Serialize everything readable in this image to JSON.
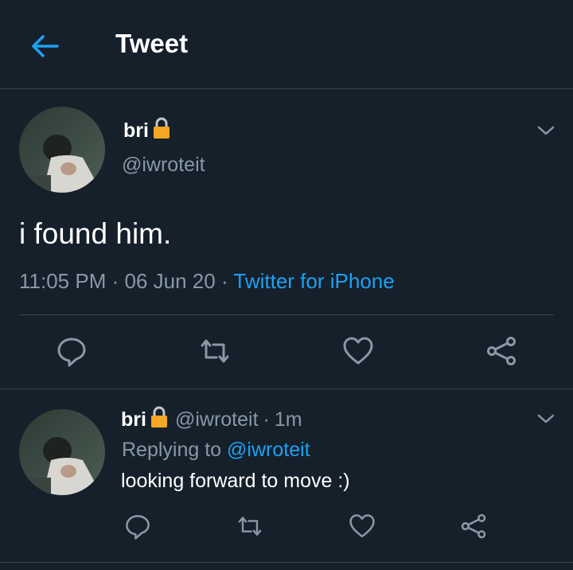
{
  "header": {
    "title": "Tweet",
    "back_icon": "arrow-left-icon",
    "accent": "#1da1f2"
  },
  "main_tweet": {
    "name": "bri",
    "handle": "@iwroteit",
    "lock_icon": "lock-icon",
    "text": "i found him.",
    "time": "11:05 PM",
    "date": "06 Jun 20",
    "sep": "·",
    "source": "Twitter for iPhone",
    "actions": [
      "reply-icon",
      "retweet-icon",
      "like-icon",
      "share-icon"
    ]
  },
  "reply_tweet": {
    "name": "bri",
    "handle": "@iwroteit",
    "sep": "·",
    "time": "1m",
    "replying_prefix": "Replying to",
    "replying_to": "@iwroteit",
    "text": "looking forward to move :)",
    "actions": [
      "reply-icon",
      "retweet-icon",
      "like-icon",
      "share-icon"
    ]
  },
  "colors": {
    "background": "#15202b",
    "border": "#38444d",
    "secondary_text": "#8899a6",
    "link": "#1da1f2"
  }
}
